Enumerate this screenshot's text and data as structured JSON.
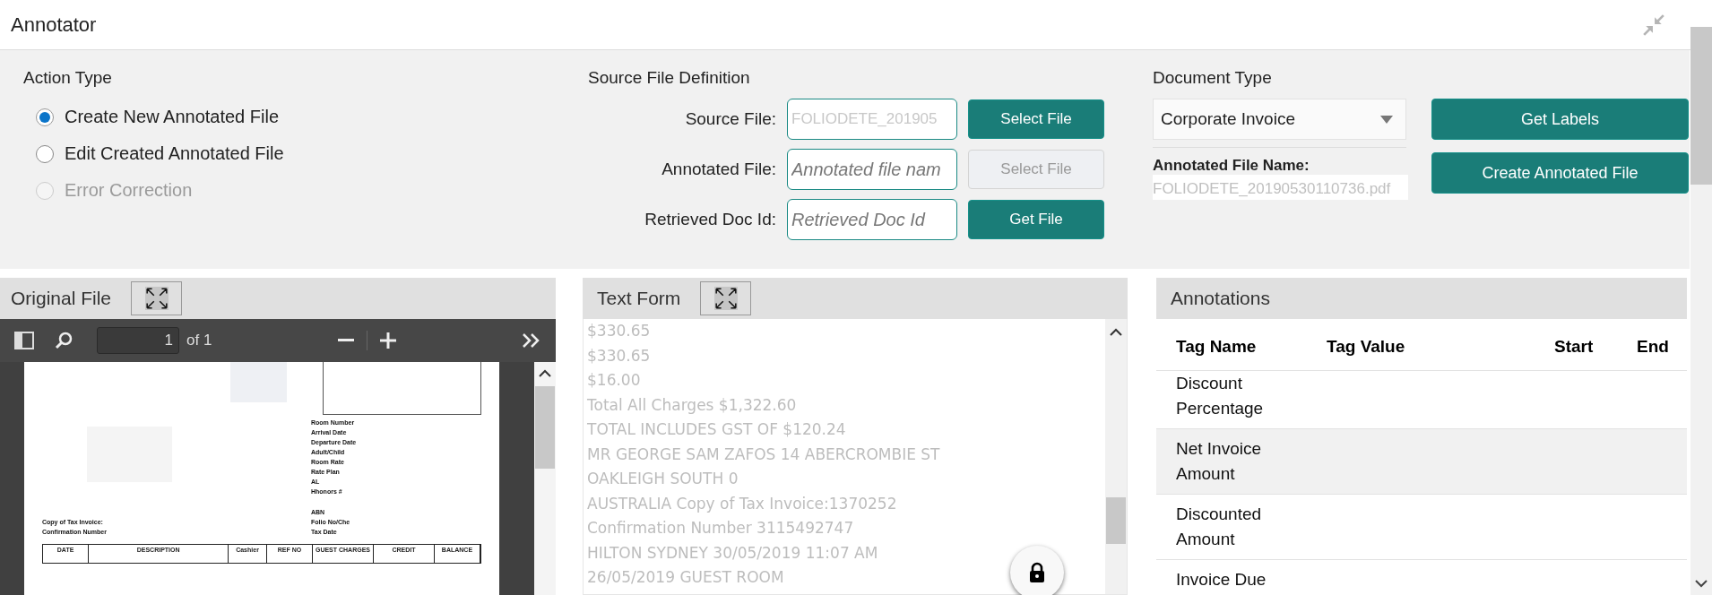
{
  "window": {
    "title": "Annotator"
  },
  "action_type": {
    "heading": "Action Type",
    "options": [
      {
        "label": "Create New Annotated File",
        "selected": true,
        "disabled": false
      },
      {
        "label": "Edit Created Annotated File",
        "selected": false,
        "disabled": false
      },
      {
        "label": "Error Correction",
        "selected": false,
        "disabled": true
      }
    ]
  },
  "source_file_definition": {
    "heading": "Source File Definition",
    "fields": [
      {
        "label": "Source File:",
        "value": "FOLIODETE_201905",
        "button": {
          "label": "Select File",
          "disabled": false
        }
      },
      {
        "label": "Annotated File:",
        "placeholder": "Annotated file nam",
        "button": {
          "label": "Select File",
          "disabled": true
        }
      },
      {
        "label": "Retrieved Doc Id:",
        "placeholder": "Retrieved Doc Id",
        "button": {
          "label": "Get File",
          "disabled": false
        }
      }
    ]
  },
  "document_type": {
    "heading": "Document Type",
    "value": "Corporate Invoice",
    "annotated_file_name_label": "Annotated File Name:",
    "annotated_file_name": "FOLIODETE_20190530110736.pdf",
    "buttons": [
      "Get Labels",
      "Create Annotated File"
    ]
  },
  "original_file": {
    "title": "Original File",
    "page_number": "1",
    "page_count": "of 1",
    "document": {
      "details": [
        "Room Number",
        "Arrival Date",
        "Departure Date",
        "Adult/Child",
        "Room Rate",
        "Rate Plan",
        "AL",
        "Hhonors #"
      ],
      "left_labels": [
        "Copy of Tax Invoice:",
        "Confirmation Number"
      ],
      "details_2": [
        "ABN",
        "Folio No/Che",
        "Tax Date"
      ],
      "columns": [
        "DATE",
        "DESCRIPTION",
        "Cashier",
        "REF NO",
        "GUEST CHARGES",
        "CREDIT",
        "BALANCE"
      ]
    }
  },
  "text_form": {
    "title": "Text Form",
    "lines": [
      "$330.65",
      "$330.65",
      "$16.00",
      "Total All Charges $1,322.60",
      "TOTAL INCLUDES GST OF $120.24",
      "MR GEORGE SAM ZAFOS 14 ABERCROMBIE ST",
      "OAKLEIGH SOUTH  0",
      "AUSTRALIA Copy of Tax Invoice:1370252",
      "Confirmation Number 3115492747",
      "HILTON SYDNEY 30/05/2019 11:07 AM",
      "26/05/2019 GUEST ROOM"
    ]
  },
  "annotations": {
    "title": "Annotations",
    "columns": [
      "Tag Name",
      "Tag Value",
      "Start",
      "End"
    ],
    "rows": [
      {
        "tag_name": "Discount Percentage",
        "selected": false
      },
      {
        "tag_name": "Net Invoice Amount",
        "selected": true
      },
      {
        "tag_name": "Discounted Amount",
        "selected": false
      },
      {
        "tag_name": "Invoice Due",
        "selected": false
      }
    ]
  }
}
